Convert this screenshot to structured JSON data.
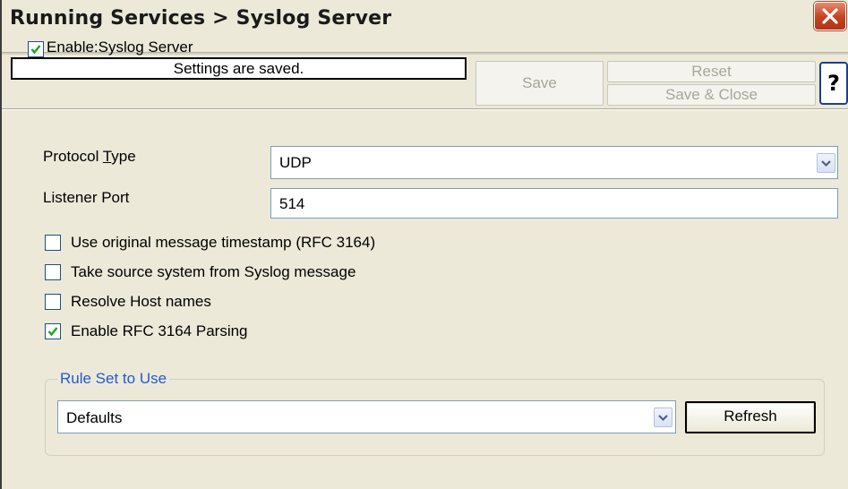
{
  "window": {
    "title": "Running Services > Syslog Server",
    "close_icon": "close-icon"
  },
  "toolbar": {
    "enable_label": "Enable:Syslog Server",
    "enable_checked": true,
    "status_text": "Settings are saved.",
    "save_label": "Save",
    "reset_label": "Reset",
    "save_close_label": "Save & Close",
    "help_label": "?"
  },
  "form": {
    "protocol_label_pre": "Protocol ",
    "protocol_label_u": "T",
    "protocol_label_post": "ype",
    "protocol_value": "UDP",
    "port_label": "Listener Port",
    "port_value": "514"
  },
  "options": [
    {
      "label": "Use original message timestamp (RFC 3164)",
      "checked": false
    },
    {
      "label": "Take source system from Syslog message",
      "checked": false
    },
    {
      "label": "Resolve Host names",
      "checked": false
    },
    {
      "label": "Enable RFC 3164 Parsing",
      "checked": true
    }
  ],
  "rule_set": {
    "group_title": "Rule Set to Use",
    "selected": "Defaults",
    "refresh_label": "Refresh"
  },
  "colors": {
    "window_bg": "#ece9d8",
    "group_title": "#1f5ad6",
    "checkmark": "#21a121",
    "close_red": "#c4421f"
  }
}
